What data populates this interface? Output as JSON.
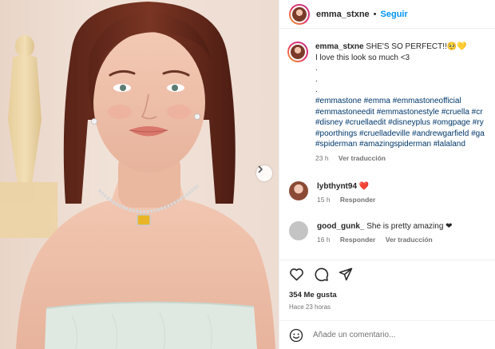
{
  "header": {
    "username": "emma_stxne",
    "separator": "•",
    "follow_label": "Seguir"
  },
  "caption": {
    "username": "emma_stxne",
    "line1": "SHE'S SO PERFECT!!🥺💛",
    "line2": "I love this look so much <3",
    "dots": [
      ".",
      ".",
      "."
    ],
    "hashtag_lines": [
      "#emmastone #emma #emmastoneofficial",
      "#emmastoneedit #emmastonestyle #cruella #cr",
      "#disney #cruellaedit #disneyplus #omgpage #ry",
      "#poorthings #cruelladeville #andrewgarfield #ga",
      "#spiderman #amazingspiderman #lalaland"
    ],
    "time": "23 h",
    "translate_label": "Ver traducción"
  },
  "comments": [
    {
      "username": "lybthynt94",
      "text": "❤️",
      "time": "15 h",
      "reply_label": "Responder",
      "translate_label": ""
    },
    {
      "username": "good_gunk_",
      "text": "She is pretty amazing ❤",
      "time": "16 h",
      "reply_label": "Responder",
      "translate_label": "Ver traducción"
    }
  ],
  "likes_text": "354 Me gusta",
  "posted_time": "Hace 23 horas",
  "comment_input": {
    "placeholder": "Añade un comentario..."
  },
  "icons": {
    "like": "heart-icon",
    "comment": "comment-icon",
    "share": "share-icon",
    "emoji": "emoji-icon",
    "next": "chevron-right-icon"
  },
  "colors": {
    "accent": "#0095f6",
    "hashtag": "#00376b",
    "muted": "#737373",
    "like_red": "#ed4956"
  }
}
